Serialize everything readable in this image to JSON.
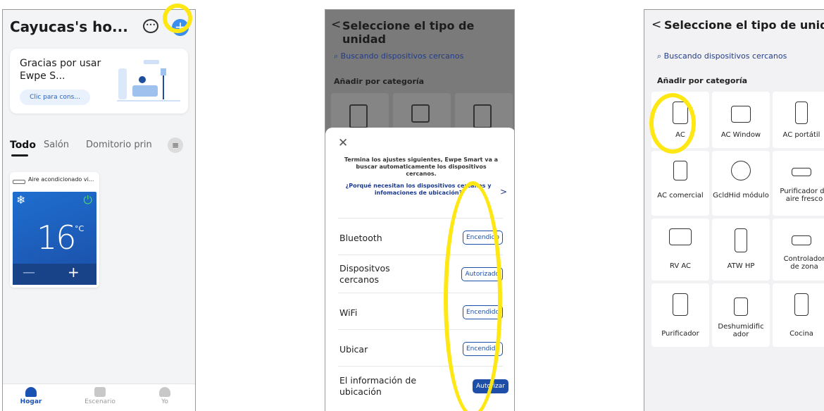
{
  "screen1": {
    "home_title": "Cayucas's ho...",
    "message_icon": "chat-bubble-icon",
    "add_icon": "plus-icon",
    "promo_text": "Gracias por usar Ewpe S...",
    "promo_button": "Clic para cons...",
    "tabs": [
      "Todo",
      "Salón",
      "Domitorio prin"
    ],
    "device_name": "Aire acondicionado vi...",
    "temperature": "16",
    "temp_unit": "°C",
    "minus_symbol": "—",
    "plus_symbol": "+",
    "tabbar": [
      "Hogar",
      "Escenario",
      "Yo"
    ]
  },
  "screen2": {
    "back": "<",
    "title": "Seleccione el tipo de unidad",
    "search_text": "Buscando dispositivos cercanos",
    "category_heading": "Añadir por categoría",
    "close": "✕",
    "description": "Termina los ajustes siguientes, Ewpe Smart va a buscar automaticamente los dispositivos cercanos.",
    "link_text": "¿Porqué necesitan los dispositivos cercanos y infomaciones de ubicación?",
    "link_arrow": ">",
    "permissions": [
      {
        "label": "Bluetooth",
        "button": "Encendido"
      },
      {
        "label": "Dispositvos cercanos",
        "button": "Autorizado"
      },
      {
        "label": "WiFi",
        "button": "Encendido"
      },
      {
        "label": "Ubicar",
        "button": "Encendido"
      },
      {
        "label": "El información de ubicación",
        "button": "Autorizar"
      }
    ]
  },
  "screen3": {
    "back": "<",
    "title": "Seleccione el tipo de unidad",
    "search_text": "Buscando dispositivos cercanos",
    "category_heading": "Añadir por categoría",
    "categories": [
      "AC",
      "AC Window",
      "AC portátil",
      "AC comercial",
      "GcldHid módulo",
      "Purificador de aire fresco",
      "RV AC",
      "ATW HP",
      "Controlador de zona",
      "Purificador",
      "Deshumidificador",
      "Cocina"
    ]
  },
  "colors": {
    "highlight": "#ffe714",
    "primary_blue": "#1d4fa8",
    "add_button": "#3b8ef0"
  }
}
